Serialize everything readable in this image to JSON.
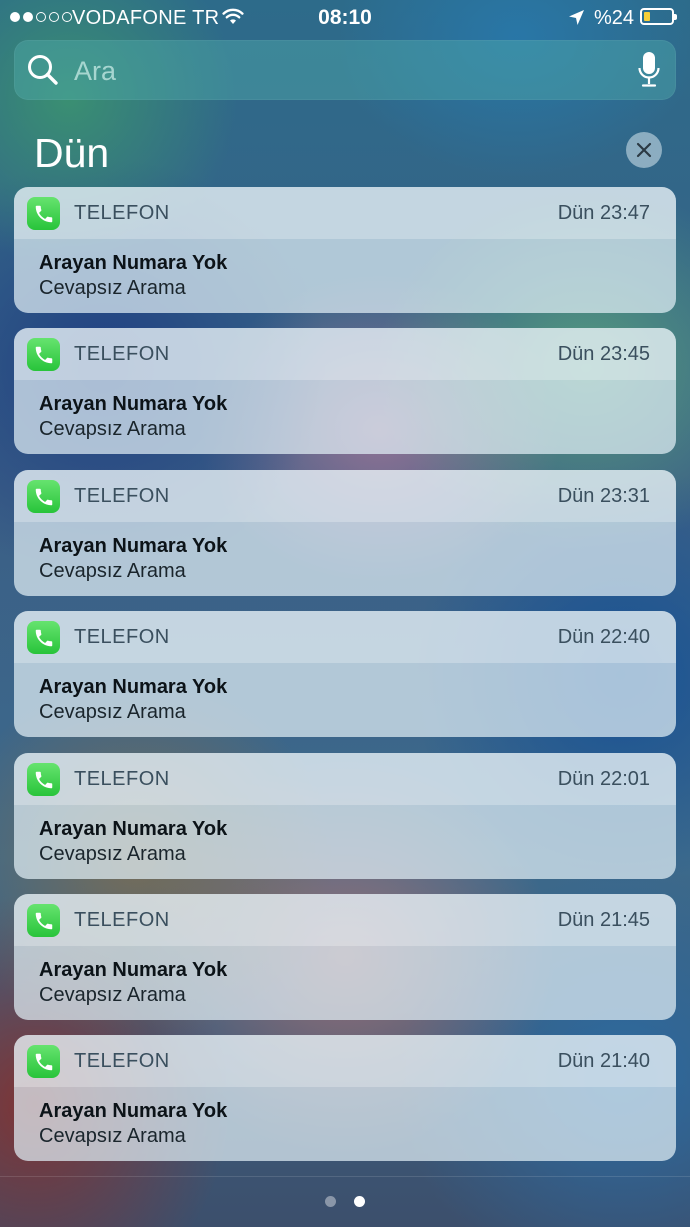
{
  "status_bar": {
    "signal_bars": 5,
    "signal_filled": 2,
    "carrier": "VODAFONE TR",
    "time": "08:10",
    "battery_text": "%24",
    "battery_level": 0.24,
    "battery_color": "#f6cf3a"
  },
  "search": {
    "placeholder": "Ara"
  },
  "section": {
    "title": "Dün"
  },
  "notifications": [
    {
      "app": "TELEFON",
      "time": "Dün 23:47",
      "title": "Arayan Numara Yok",
      "body": "Cevapsız Arama"
    },
    {
      "app": "TELEFON",
      "time": "Dün 23:45",
      "title": "Arayan Numara Yok",
      "body": "Cevapsız Arama"
    },
    {
      "app": "TELEFON",
      "time": "Dün 23:31",
      "title": "Arayan Numara Yok",
      "body": "Cevapsız Arama"
    },
    {
      "app": "TELEFON",
      "time": "Dün 22:40",
      "title": "Arayan Numara Yok",
      "body": "Cevapsız Arama"
    },
    {
      "app": "TELEFON",
      "time": "Dün 22:01",
      "title": "Arayan Numara Yok",
      "body": "Cevapsız Arama"
    },
    {
      "app": "TELEFON",
      "time": "Dün 21:45",
      "title": "Arayan Numara Yok",
      "body": "Cevapsız Arama"
    },
    {
      "app": "TELEFON",
      "time": "Dün 21:40",
      "title": "Arayan Numara Yok",
      "body": "Cevapsız Arama"
    }
  ],
  "icons": {
    "app": "phone-icon",
    "search": "search-icon",
    "mic": "microphone-icon",
    "clear": "close-icon"
  },
  "page_dots": {
    "count": 2,
    "active": 1
  },
  "accent_color": "#28c43a"
}
